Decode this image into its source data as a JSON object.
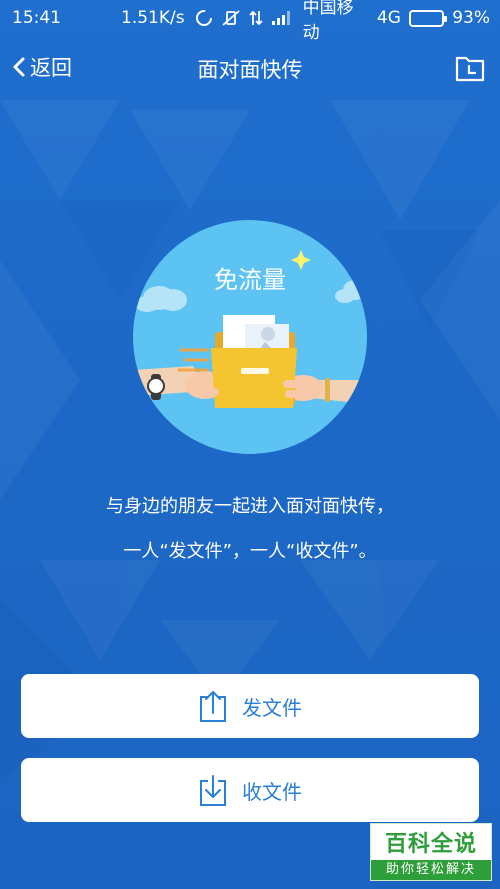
{
  "status_bar": {
    "time": "15:41",
    "speed": "1.51K/s",
    "carrier": "中国移动",
    "network": "4G",
    "battery_percent": "93%",
    "battery_level": 0.93
  },
  "header": {
    "back_label": "返回",
    "title": "面对面快传"
  },
  "hero": {
    "badge_text": "免流量"
  },
  "description": {
    "line1": "与身边的朋友一起进入面对面快传，",
    "line2": "一人“发文件”，一人“收文件”。"
  },
  "actions": {
    "send_label": "发文件",
    "receive_label": "收文件"
  },
  "watermark": {
    "title": "百科全说",
    "subtitle": "助你轻松解决"
  },
  "colors": {
    "background": "#1e6bcb",
    "accent": "#2a7fd6",
    "folder": "#f2c233",
    "circle": "#5cc3f2"
  }
}
